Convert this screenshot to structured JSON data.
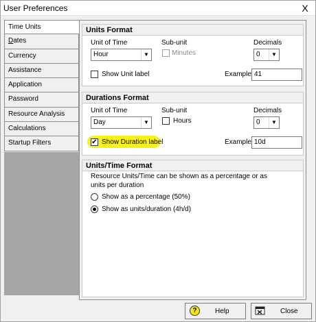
{
  "window": {
    "title": "User Preferences",
    "close_glyph": "X",
    "close_icon": "close-icon"
  },
  "tabs": [
    {
      "label": "Time Units",
      "active": true
    },
    {
      "label": "Dates"
    },
    {
      "label": "Currency"
    },
    {
      "label": "Assistance"
    },
    {
      "label": "Application"
    },
    {
      "label": "Password"
    },
    {
      "label": "Resource Analysis"
    },
    {
      "label": "Calculations"
    },
    {
      "label": "Startup Filters"
    }
  ],
  "units_format": {
    "heading": "Units Format",
    "unit_of_time_label": "Unit of Time",
    "unit_of_time_value": "Hour",
    "subunit_label": "Sub-unit",
    "subunit_option": "Minutes",
    "subunit_checked": false,
    "subunit_enabled": false,
    "decimals_label": "Decimals",
    "decimals_value": "0",
    "show_label": "Show Unit label",
    "show_checked": false,
    "example_label": "Example",
    "example_value": "41"
  },
  "durations_format": {
    "heading": "Durations Format",
    "unit_of_time_label": "Unit of Time",
    "unit_of_time_value": "Day",
    "subunit_label": "Sub-unit",
    "subunit_option": "Hours",
    "subunit_checked": false,
    "decimals_label": "Decimals",
    "decimals_value": "0",
    "show_label": "Show Duration label",
    "show_checked": true,
    "check_glyph": "✔",
    "example_label": "Example",
    "example_value": "10d",
    "highlight_color": "#f7f21e"
  },
  "units_time_format": {
    "heading": "Units/Time Format",
    "description_line1": "Resource Units/Time can be shown as a percentage or as",
    "description_line2": "units per duration",
    "options": [
      {
        "label": "Show as a percentage (50%)",
        "selected": false
      },
      {
        "label": "Show as units/duration (4h/d)",
        "selected": true
      }
    ]
  },
  "footer": {
    "help_label": "Help",
    "help_icon": "?",
    "close_label": "Close"
  },
  "colors": {
    "accent_highlight": "#f7f21e",
    "panel_bg": "#f0f0f0",
    "tab_fill": "#a6a6a6"
  }
}
